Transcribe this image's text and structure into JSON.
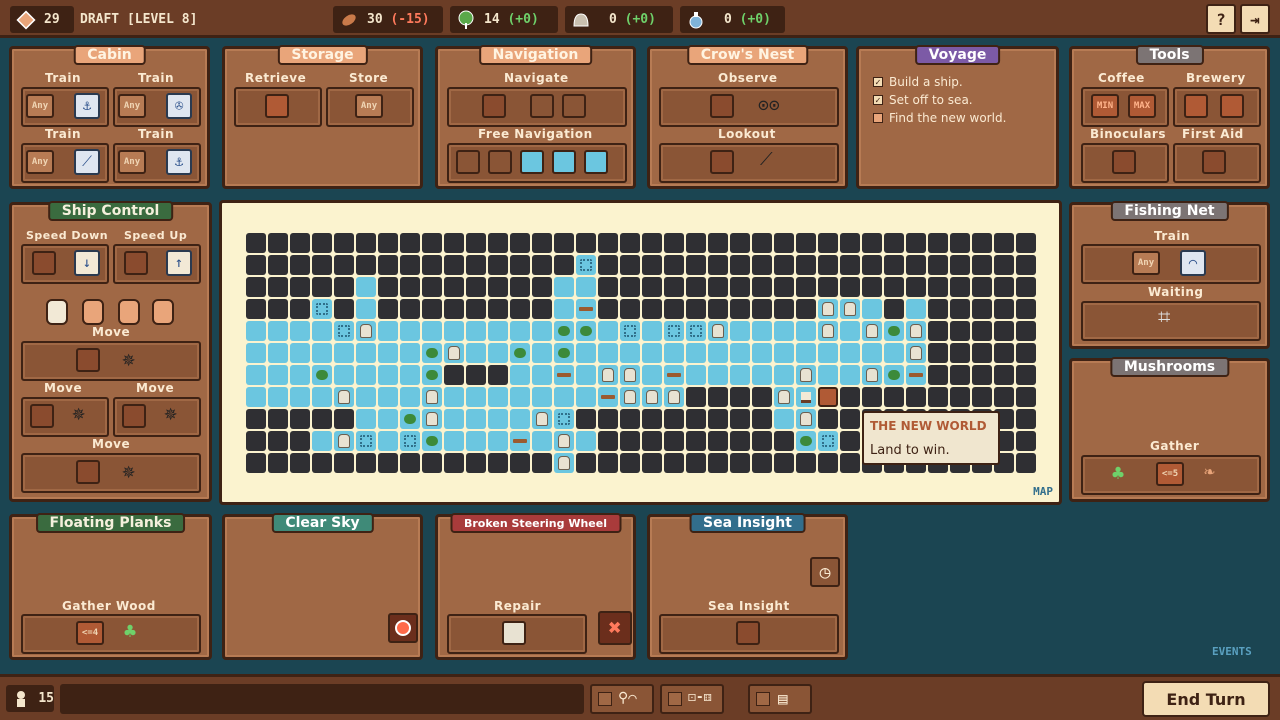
{
  "top": {
    "draft_count": "29",
    "draft_label": "DRAFT [LEVEL 8]",
    "food": {
      "value": "30",
      "delta": "(-15)"
    },
    "wood": {
      "value": "14",
      "delta": "(+0)"
    },
    "stone": {
      "value": "0",
      "delta": "(+0)"
    },
    "potion": {
      "value": "0",
      "delta": "(+0)"
    },
    "help": "?",
    "exit": "⇥"
  },
  "panels": {
    "cabin": {
      "title": "Cabin",
      "l1": "Train",
      "l2": "Train",
      "l3": "Train",
      "l4": "Train",
      "any": "Any"
    },
    "storage": {
      "title": "Storage",
      "l1": "Retrieve",
      "l2": "Store",
      "any": "Any"
    },
    "navigation": {
      "title": "Navigation",
      "l1": "Navigate",
      "l2": "Free Navigation"
    },
    "crows": {
      "title": "Crow's Nest",
      "l1": "Observe",
      "l2": "Lookout"
    },
    "voyage": {
      "title": "Voyage",
      "items": [
        "Build a ship.",
        "Set off to sea.",
        "Find the new world."
      ],
      "checks": [
        "✓",
        "✓",
        ""
      ]
    },
    "tools": {
      "title": "Tools",
      "l1": "Coffee",
      "l2": "Brewery",
      "l3": "Binoculars",
      "l4": "First Aid",
      "min": "MIN",
      "max": "MAX"
    },
    "ship": {
      "title": "Ship Control",
      "l1": "Speed Down",
      "l2": "Speed Up",
      "l3": "Move",
      "l4": "Move",
      "l5": "Move",
      "l6": "Move"
    },
    "fishing": {
      "title": "Fishing Net",
      "l1": "Train",
      "l2": "Waiting",
      "any": "Any"
    },
    "mush": {
      "title": "Mushrooms",
      "l1": "Gather",
      "cond": "<=5"
    },
    "planks": {
      "title": "Floating Planks",
      "l1": "Gather Wood",
      "cond": "<=4"
    },
    "sky": {
      "title": "Clear Sky"
    },
    "wheel": {
      "title": "Broken Steering Wheel",
      "l1": "Repair"
    },
    "insight": {
      "title": "Sea Insight",
      "l1": "Sea Insight"
    }
  },
  "map": {
    "label": "MAP",
    "tooltip_title": "THE NEW WORLD",
    "tooltip_text": "Land to win."
  },
  "events_label": "EVENTS",
  "bottom": {
    "workers": "15",
    "end_turn": "End Turn"
  }
}
